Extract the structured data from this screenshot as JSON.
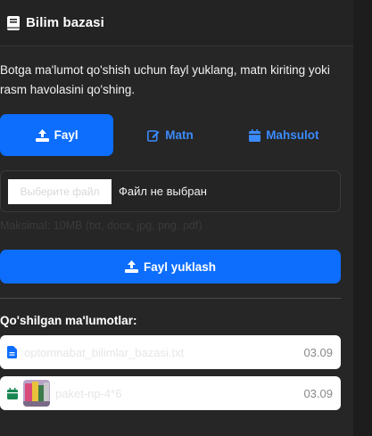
{
  "header": {
    "title": "Bilim bazasi",
    "icon": "book-icon"
  },
  "description": "Botga ma'lumot qo'shish uchun fayl yuklang, matn kiriting yoki rasm havolasini qo'shing.",
  "tabs": [
    {
      "label": "Fayl",
      "icon": "upload-icon",
      "active": true
    },
    {
      "label": "Matn",
      "icon": "edit-icon",
      "active": false
    },
    {
      "label": "Mahsulot",
      "icon": "box-icon",
      "active": false
    }
  ],
  "file_input": {
    "button_label": "Выберите файл",
    "status": "Файл не выбран"
  },
  "hint": "Maksimal: 10MB (txt, docx, jpg, png, pdf)",
  "upload_button": {
    "label": "Fayl yuklash",
    "icon": "upload-icon"
  },
  "section_title": "Qo'shilgan ma'lumotlar:",
  "items": [
    {
      "name": "optomnabat_bilimlar_bazasi.txt",
      "date": "03.09",
      "icon": "file-icon"
    },
    {
      "name": "paket-np-4*6",
      "date": "03.09",
      "icon": "box-icon"
    }
  ],
  "colors": {
    "accent": "#0d6efd",
    "link": "#3b8bff",
    "background": "#262626",
    "item_file_icon": "#0d6efd",
    "item_box_icon": "#198754"
  }
}
